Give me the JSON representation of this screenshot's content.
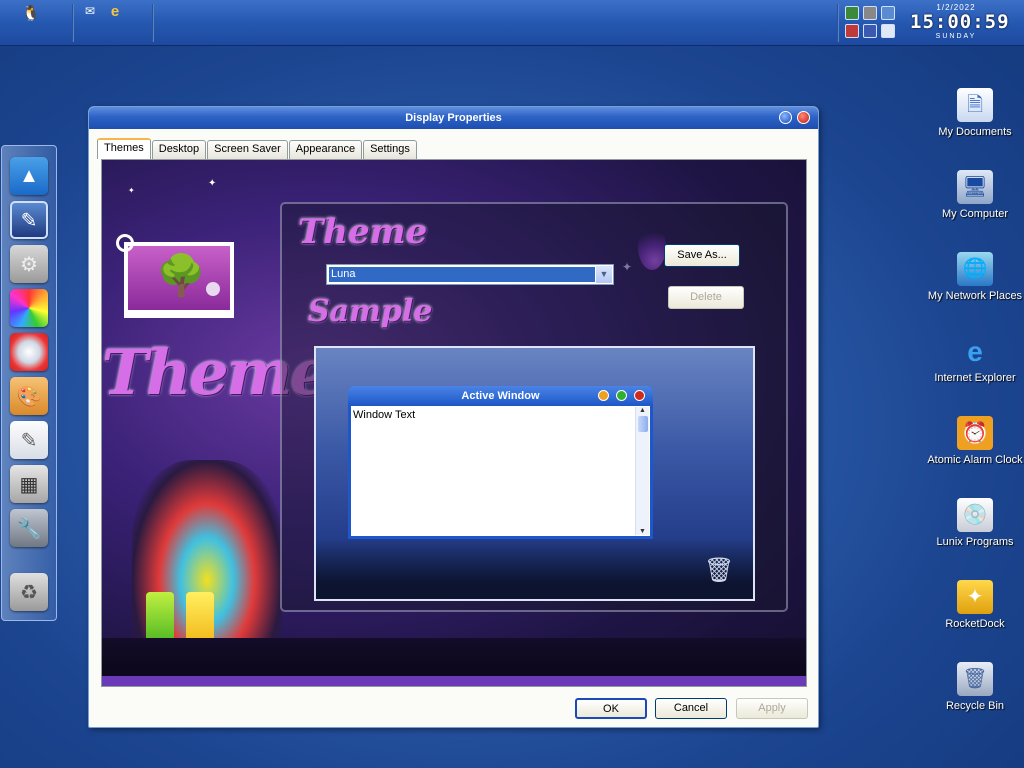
{
  "taskbar": {
    "clock": {
      "date": "1/2/2022",
      "time": "15:00:59",
      "day": "SUNDAY"
    }
  },
  "dialog": {
    "title": "Display Properties",
    "tabs": [
      "Themes",
      "Desktop",
      "Screen Saver",
      "Appearance",
      "Settings"
    ],
    "art_title": "Themes",
    "theme_label": "Theme",
    "sample_label": "Sample",
    "theme_select_value": "Luna",
    "save_as_label": "Save As...",
    "delete_label": "Delete",
    "sample_window": {
      "title": "Active Window",
      "text": "Window Text"
    },
    "ok_label": "OK",
    "cancel_label": "Cancel",
    "apply_label": "Apply"
  },
  "desktop_icons": [
    {
      "label": "My Documents",
      "icon": "my-documents-icon"
    },
    {
      "label": "My Computer",
      "icon": "my-computer-icon"
    },
    {
      "label": "My Network Places",
      "icon": "network-places-icon"
    },
    {
      "label": "Internet Explorer",
      "icon": "internet-explorer-icon"
    },
    {
      "label": "Atomic Alarm Clock",
      "icon": "alarm-clock-icon"
    },
    {
      "label": "Lunix Programs",
      "icon": "lunix-programs-icon"
    },
    {
      "label": "RocketDock",
      "icon": "rocketdock-icon"
    },
    {
      "label": "Recycle Bin",
      "icon": "recycle-bin-icon"
    }
  ],
  "dock_items": [
    "arch-linux-icon",
    "display-properties-icon",
    "gears-icon",
    "color-wheel-icon",
    "browser-globe-icon",
    "paint-palette-icon",
    "notepad-icon",
    "calculator-icon",
    "tools-icon",
    "recycle-bin-icon"
  ],
  "colors": {
    "accent": "#316ac5",
    "titlebar": "#2d62c6",
    "theme_script": "#d66ee8"
  }
}
